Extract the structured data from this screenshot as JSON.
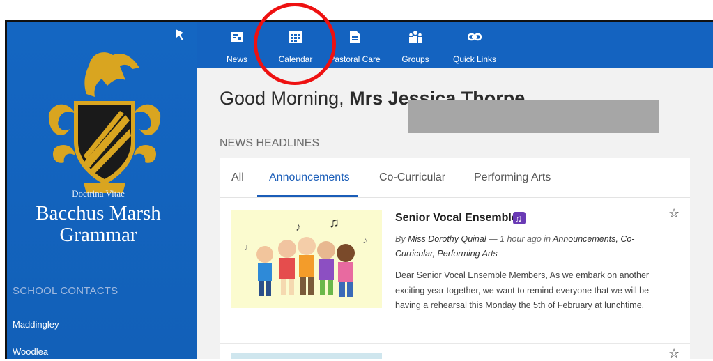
{
  "sidebar": {
    "motto": "Doctrina Vitae",
    "school_name": "Bacchus Marsh Grammar",
    "contacts_heading": "SCHOOL CONTACTS",
    "contacts": [
      "Maddingley",
      "Woodlea"
    ],
    "colors": {
      "sidebar_bg": "#1565c0",
      "crest_gold": "#d9a520",
      "crest_dark": "#1a1a1a"
    }
  },
  "nav": {
    "items": [
      {
        "label": "News",
        "icon": "news-icon"
      },
      {
        "label": "Calendar",
        "icon": "calendar-icon"
      },
      {
        "label": "Pastoral Care",
        "icon": "document-icon"
      },
      {
        "label": "Groups",
        "icon": "groups-icon"
      },
      {
        "label": "Quick Links",
        "icon": "link-icon"
      }
    ]
  },
  "main": {
    "greeting_prefix": "Good Morning, ",
    "greeting_name": "Mrs Jessica Thorpe",
    "news_heading": "NEWS HEADLINES",
    "tabs": [
      {
        "label": "All",
        "active": false
      },
      {
        "label": "Announcements",
        "active": true
      },
      {
        "label": "Co-Curricular",
        "active": false
      },
      {
        "label": "Performing Arts",
        "active": false
      }
    ],
    "news_item": {
      "title": "Senior Vocal Ensemble",
      "by_prefix": "By ",
      "author": "Miss Dorothy Quinal",
      "time_sep": " — 1 hour ago in ",
      "categories": "Announcements, Co-Curricular, Performing Arts",
      "body": "Dear Senior Vocal Ensemble Members, As we embark on another exciting year together, we want to remind everyone that we will be having a rehearsal this Monday the 5th of February at lunchtime."
    }
  }
}
